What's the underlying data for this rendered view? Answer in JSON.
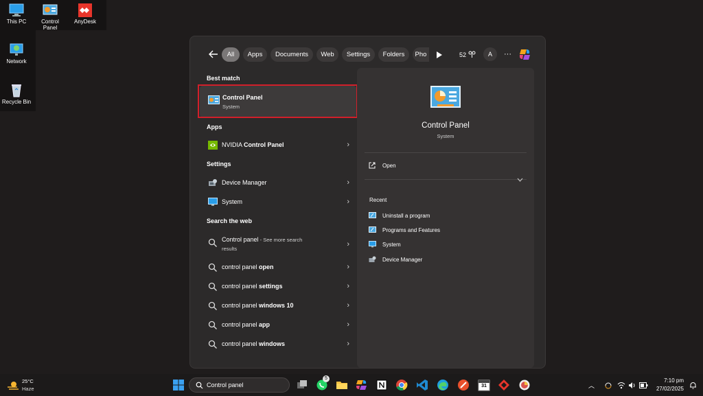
{
  "desktop": {
    "icons": [
      {
        "label": "This PC"
      },
      {
        "label": "Control Panel"
      },
      {
        "label": "AnyDesk"
      },
      {
        "label": "Network"
      },
      {
        "label": "Recycle Bin"
      }
    ]
  },
  "search": {
    "filters": [
      "All",
      "Apps",
      "Documents",
      "Web",
      "Settings",
      "Folders",
      "Pho"
    ],
    "points": "52",
    "avatar": "A",
    "more": "···"
  },
  "results": {
    "best_match_header": "Best match",
    "best_match": {
      "title": "Control Panel",
      "subtitle": "System"
    },
    "apps_header": "Apps",
    "apps": [
      {
        "pre": "NVIDIA ",
        "bold": "Control Panel"
      }
    ],
    "settings_header": "Settings",
    "settings": [
      {
        "label": "Device Manager"
      },
      {
        "label": "System"
      }
    ],
    "web_header": "Search the web",
    "web_first": {
      "label": "Control panel",
      "suffix": " - See more search",
      "suffix2": "results"
    },
    "web": [
      {
        "pre": "control panel ",
        "bold": "open"
      },
      {
        "pre": "control panel ",
        "bold": "settings"
      },
      {
        "pre": "control panel ",
        "bold": "windows 10"
      },
      {
        "pre": "control panel ",
        "bold": "app"
      },
      {
        "pre": "control panel ",
        "bold": "windows"
      }
    ]
  },
  "preview": {
    "title": "Control Panel",
    "subtitle": "System",
    "open_label": "Open",
    "recent_header": "Recent",
    "recent": [
      {
        "label": "Uninstall a program"
      },
      {
        "label": "Programs and Features"
      },
      {
        "label": "System"
      },
      {
        "label": "Device Manager"
      }
    ]
  },
  "taskbar": {
    "weather_temp": "25°C",
    "weather_desc": "Haze",
    "search_value": "Control panel",
    "whatsapp_badge": "5",
    "calendar_day": "31",
    "time": "7:10 pm",
    "date": "27/02/2025"
  },
  "colors": {
    "highlight": "#d21f2a",
    "accent_blue": "#0067c0"
  }
}
